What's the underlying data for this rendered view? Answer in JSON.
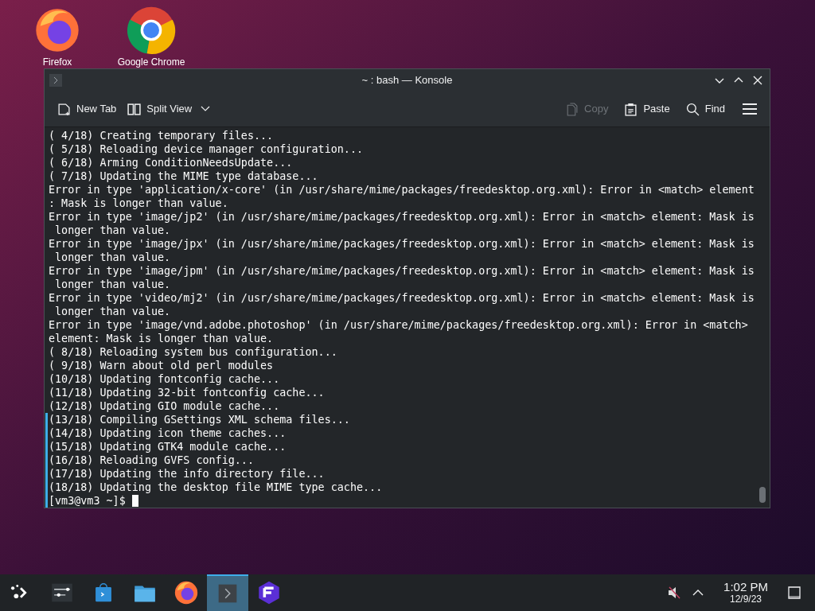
{
  "desktop_icons": [
    {
      "kind": "firefox",
      "label": "Firefox"
    },
    {
      "kind": "chrome",
      "label": "Google Chrome"
    }
  ],
  "window": {
    "title": "~ : bash — Konsole",
    "toolbar_left": [
      {
        "kind": "new-tab",
        "label": "New Tab",
        "disabled": false
      },
      {
        "kind": "split-view",
        "label": "Split View",
        "disabled": false
      }
    ],
    "toolbar_right": [
      {
        "kind": "copy",
        "label": "Copy",
        "disabled": true
      },
      {
        "kind": "paste",
        "label": "Paste",
        "disabled": false
      },
      {
        "kind": "find",
        "label": "Find",
        "disabled": false
      }
    ]
  },
  "terminal": {
    "lines": [
      {
        "text": "( 4/18) Creating temporary files...",
        "marked": false
      },
      {
        "text": "( 5/18) Reloading device manager configuration...",
        "marked": false
      },
      {
        "text": "( 6/18) Arming ConditionNeedsUpdate...",
        "marked": false
      },
      {
        "text": "( 7/18) Updating the MIME type database...",
        "marked": false
      },
      {
        "text": "Error in type 'application/x-core' (in /usr/share/mime/packages/freedesktop.org.xml): Error in <match> element",
        "marked": false
      },
      {
        "text": ": Mask is longer than value.",
        "marked": false
      },
      {
        "text": "Error in type 'image/jp2' (in /usr/share/mime/packages/freedesktop.org.xml): Error in <match> element: Mask is",
        "marked": false
      },
      {
        "text": " longer than value.",
        "marked": false
      },
      {
        "text": "Error in type 'image/jpx' (in /usr/share/mime/packages/freedesktop.org.xml): Error in <match> element: Mask is",
        "marked": false
      },
      {
        "text": " longer than value.",
        "marked": false
      },
      {
        "text": "Error in type 'image/jpm' (in /usr/share/mime/packages/freedesktop.org.xml): Error in <match> element: Mask is",
        "marked": false
      },
      {
        "text": " longer than value.",
        "marked": false
      },
      {
        "text": "Error in type 'video/mj2' (in /usr/share/mime/packages/freedesktop.org.xml): Error in <match> element: Mask is",
        "marked": false
      },
      {
        "text": " longer than value.",
        "marked": false
      },
      {
        "text": "Error in type 'image/vnd.adobe.photoshop' (in /usr/share/mime/packages/freedesktop.org.xml): Error in <match>",
        "marked": false
      },
      {
        "text": "element: Mask is longer than value.",
        "marked": false
      },
      {
        "text": "( 8/18) Reloading system bus configuration...",
        "marked": false
      },
      {
        "text": "( 9/18) Warn about old perl modules",
        "marked": false
      },
      {
        "text": "(10/18) Updating fontconfig cache...",
        "marked": false
      },
      {
        "text": "(11/18) Updating 32-bit fontconfig cache...",
        "marked": false
      },
      {
        "text": "(12/18) Updating GIO module cache...",
        "marked": false
      },
      {
        "text": "(13/18) Compiling GSettings XML schema files...",
        "marked": true
      },
      {
        "text": "(14/18) Updating icon theme caches...",
        "marked": true
      },
      {
        "text": "(15/18) Updating GTK4 module cache...",
        "marked": true
      },
      {
        "text": "(16/18) Reloading GVFS config...",
        "marked": true
      },
      {
        "text": "(17/18) Updating the info directory file...",
        "marked": true
      },
      {
        "text": "(18/18) Updating the desktop file MIME type cache...",
        "marked": true
      }
    ],
    "prompt": {
      "text": "[vm3@vm3 ~]$",
      "marked": true
    }
  },
  "taskbar": {
    "apps": [
      {
        "kind": "launcher",
        "active": false
      },
      {
        "kind": "settings",
        "active": false
      },
      {
        "kind": "store",
        "active": false
      },
      {
        "kind": "files",
        "active": false
      },
      {
        "kind": "firefox",
        "active": false
      },
      {
        "kind": "terminal",
        "active": true
      },
      {
        "kind": "f-app",
        "active": false
      }
    ],
    "clock": {
      "time": "1:02 PM",
      "date": "12/9/23"
    }
  }
}
